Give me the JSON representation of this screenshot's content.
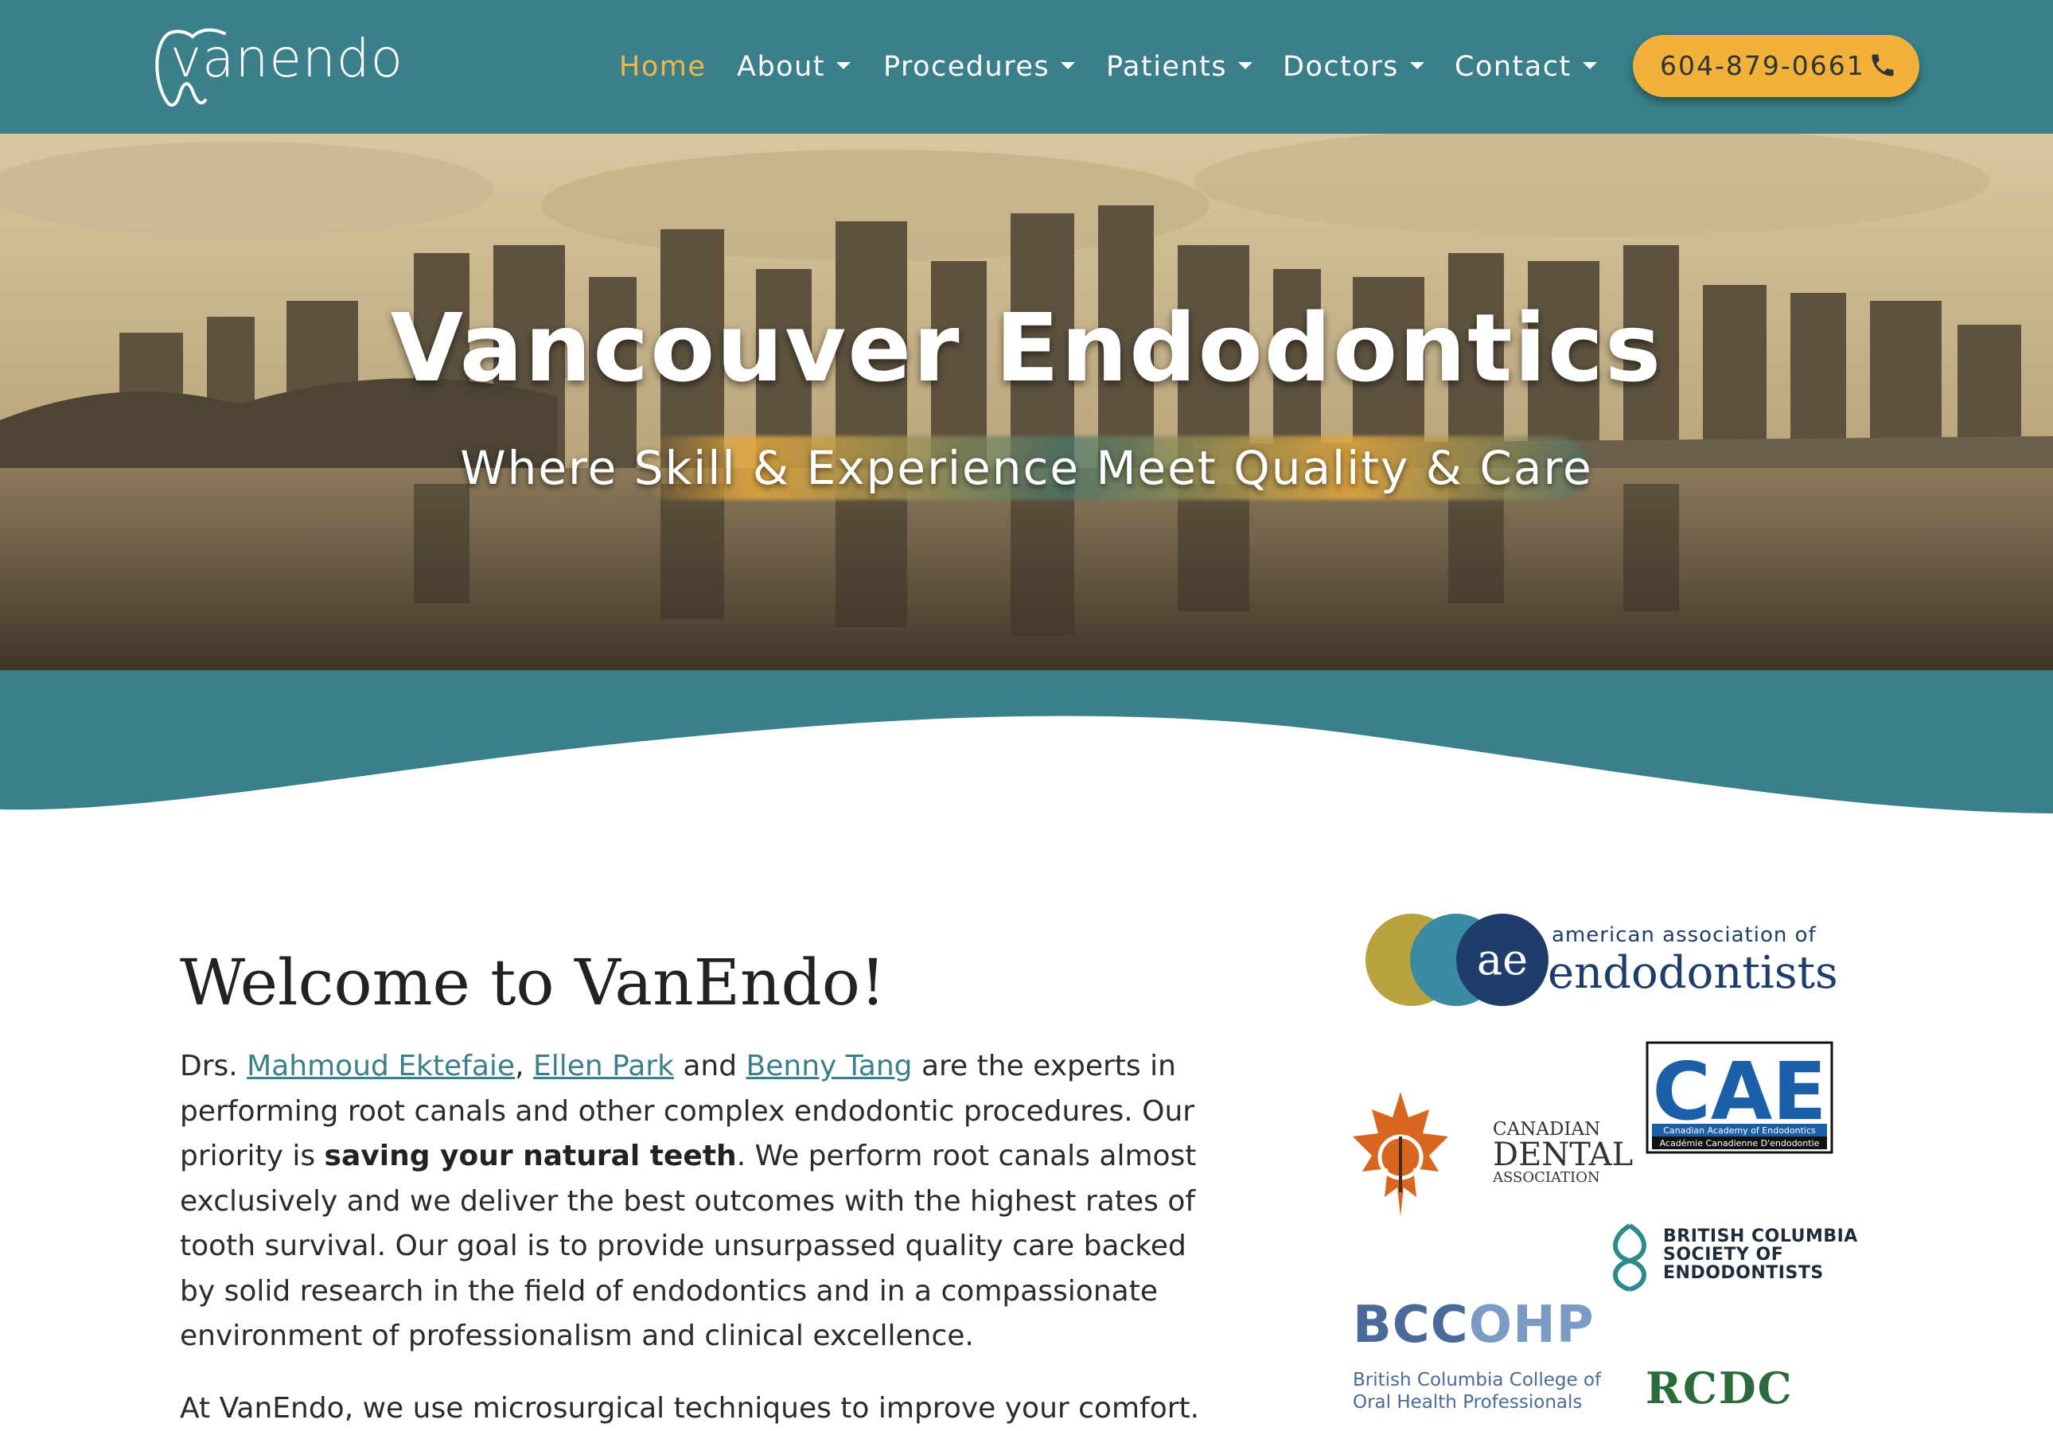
{
  "header": {
    "logo_text": "vanendo",
    "nav": [
      {
        "label": "Home",
        "active": true
      },
      {
        "label": "About",
        "dropdown": true
      },
      {
        "label": "Procedures",
        "dropdown": true
      },
      {
        "label": "Patients",
        "dropdown": true
      },
      {
        "label": "Doctors",
        "dropdown": true
      },
      {
        "label": "Contact",
        "dropdown": true
      }
    ],
    "phone": "604-879-0661",
    "phone_icon": "phone-icon"
  },
  "hero": {
    "title": "Vancouver Endodontics",
    "subtitle": "Where Skill & Experience Meet Quality & Care"
  },
  "main": {
    "heading": "Welcome to VanEndo!",
    "para1_prefix": "Drs. ",
    "doctor1": "Mahmoud Ektefaie",
    "sep1": ", ",
    "doctor2": "Ellen Park",
    "sep2": " and ",
    "doctor3": "Benny Tang",
    "para1_mid": " are the experts in performing root canals and other complex endodontic procedures. Our priority is ",
    "para1_bold": "saving your natural teeth",
    "para1_rest": ". We perform root canals almost exclusively and we deliver the best outcomes with the highest rates of tooth survival. Our goal is to provide unsurpassed quality care backed by solid research in the field of endodontics and in a compassionate environment of professionalism and clinical excellence.",
    "para2_prefix": "At ",
    "para2_brand": "VanEndo",
    "para2_rest": ", we use microsurgical techniques to improve your comfort."
  },
  "affiliations": {
    "aae_line1": "american association of",
    "aae_line2": "endodontists",
    "aae_mark": "ae",
    "cae_mark": "CAE",
    "cae_line1": "Canadian Academy of Endodontics",
    "cae_line2": "Académie Canadienne D'endodontie",
    "cda_line1": "CANADIAN",
    "cda_line2": "DENTAL",
    "cda_line3": "ASSOCIATION",
    "bcse_line1": "BRITISH COLUMBIA",
    "bcse_line2": "SOCIETY OF",
    "bcse_line3": "ENDODONTISTS",
    "bccohp_bc": "BCC",
    "bccohp_ohp": "OHP",
    "bccohp_line1": "British Columbia College of",
    "bccohp_line2": "Oral Health Professionals",
    "rcdc": "RCDC"
  },
  "colors": {
    "teal": "#3a7f89",
    "gold": "#f2b13b",
    "active_nav": "#f0b84a"
  }
}
